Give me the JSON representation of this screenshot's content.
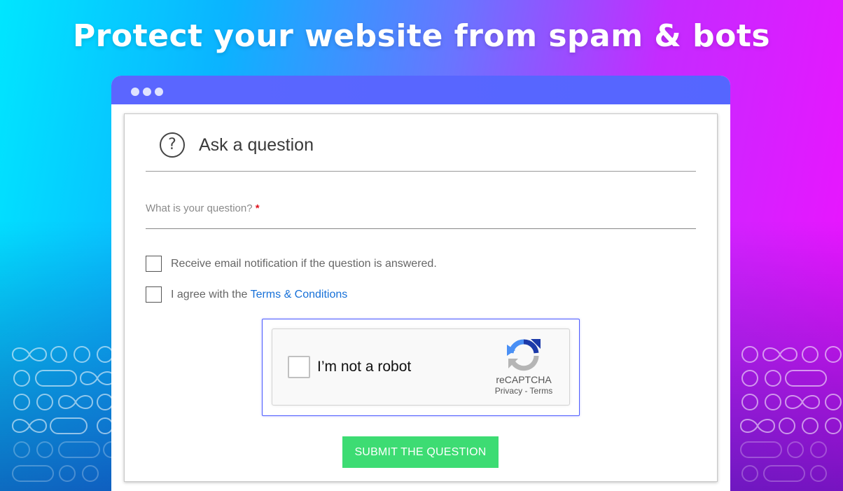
{
  "headline": "Protect your website from spam & bots",
  "colors": {
    "window_bar": "#5566ff",
    "submit_button": "#3ddc73",
    "link": "#1670d8",
    "required_marker": "#e0141e",
    "captcha_border": "#4d5cff"
  },
  "browser": {
    "window_controls": [
      "dot",
      "dot",
      "dot"
    ]
  },
  "form": {
    "header_icon": "question-circle-icon",
    "title": "Ask a question",
    "question_field": {
      "label": "What is your question?",
      "required_marker": "*"
    },
    "checkboxes": [
      {
        "label": "Receive email notification if the question is answered.",
        "checked": false
      },
      {
        "label_prefix": "I agree with the ",
        "link_text": "Terms & Conditions",
        "checked": false
      }
    ],
    "captcha": {
      "label": "I’m not a robot",
      "brand": "reCAPTCHA",
      "links": "Privacy - Terms",
      "logo_icon": "recaptcha-logo-icon",
      "checked": false
    },
    "submit_label": "SUBMIT THE QUESTION"
  },
  "decorations": {
    "pattern_icon": "infinity-circles-pattern"
  }
}
